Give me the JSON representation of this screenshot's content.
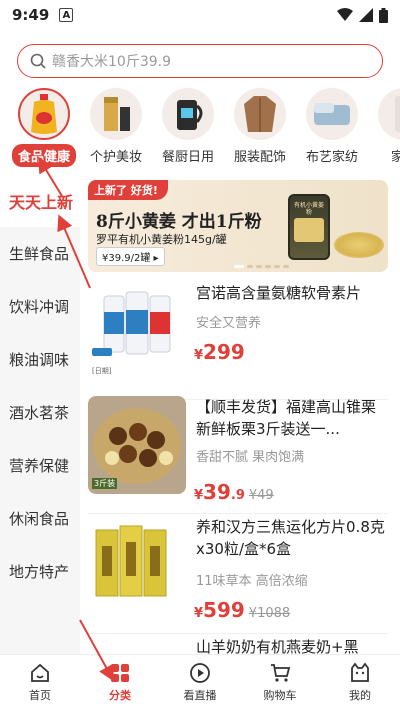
{
  "status": {
    "time": "9:49",
    "badge": "A"
  },
  "search": {
    "placeholder": "赣香大米10斤39.9"
  },
  "categories": [
    {
      "label": "食品健康"
    },
    {
      "label": "个护美妆"
    },
    {
      "label": "餐厨日用"
    },
    {
      "label": "服装配饰"
    },
    {
      "label": "布艺家纺"
    },
    {
      "label": "家电"
    }
  ],
  "sidebar": {
    "items": [
      {
        "label": "天天上新"
      },
      {
        "label": "生鲜食品"
      },
      {
        "label": "饮料冲调"
      },
      {
        "label": "粮油调味"
      },
      {
        "label": "酒水茗茶"
      },
      {
        "label": "营养保健"
      },
      {
        "label": "休闲食品"
      },
      {
        "label": "地方特产"
      }
    ]
  },
  "banner": {
    "tag": "上新了 好货!",
    "title": "8斤小黄姜 才出1斤粉",
    "subtitle": "罗平有机小黄姜粉145g/罐",
    "price": "¥39.9/2罐 ▸",
    "jar_label": "有机小黄姜粉"
  },
  "products": [
    {
      "name": "宫诺高含量氨糖软骨素片",
      "desc": "安全又营养",
      "currency": "¥",
      "price_int": "299",
      "price_dec": "",
      "orig": "",
      "thumb_label": "[日期]"
    },
    {
      "name": "【顺丰发货】福建高山锥栗新鲜板栗3斤装送一...",
      "desc": "香甜不腻 果肉饱满",
      "currency": "¥",
      "price_int": "39",
      "price_dec": ".9",
      "orig": "¥49",
      "thumb_label": "3斤装"
    },
    {
      "name": "养和汉方三焦运化方片0.8克x30粒/盒*6盒",
      "desc": "11味草本 高倍浓缩",
      "currency": "¥",
      "price_int": "599",
      "price_dec": "",
      "orig": "¥1088",
      "thumb_label": ""
    },
    {
      "name": "山羊奶奶有机燕麦奶+黑",
      "desc": "",
      "currency": "",
      "price_int": "",
      "price_dec": "",
      "orig": "",
      "thumb_label": ""
    }
  ],
  "tabs": [
    {
      "label": "首页",
      "icon": "home-icon"
    },
    {
      "label": "分类",
      "icon": "category-icon"
    },
    {
      "label": "看直播",
      "icon": "live-icon"
    },
    {
      "label": "购物车",
      "icon": "cart-icon"
    },
    {
      "label": "我的",
      "icon": "profile-icon"
    }
  ],
  "colors": {
    "accent": "#e0403a",
    "annotation": "#e0403a"
  }
}
